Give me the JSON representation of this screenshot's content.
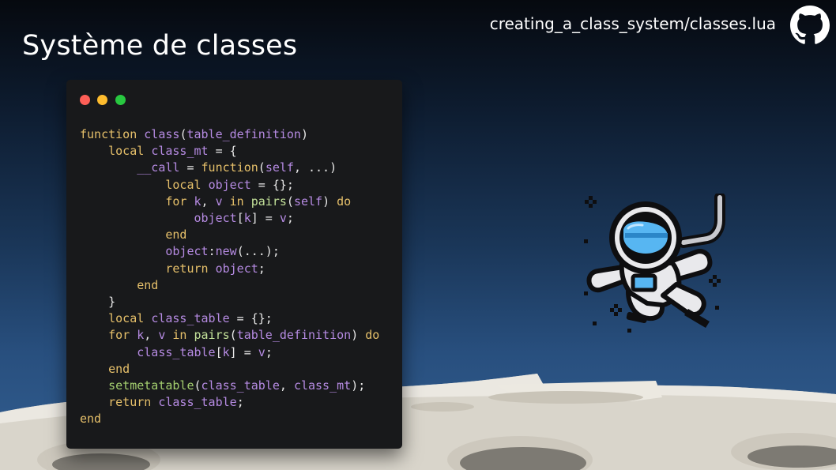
{
  "slide": {
    "title": "Système de classes",
    "file_path": "creating_a_class_system/classes.lua"
  },
  "icons": {
    "github": "github-icon",
    "astronaut": "astronaut-illustration"
  },
  "colors": {
    "background_top": "#06090f",
    "background_bottom": "#335f92",
    "code_background": "#18191b",
    "keyword": "#e6c06a",
    "identifier": "#b68be3",
    "function_call": "#a4cf6f",
    "dot_red": "#fe5f57",
    "dot_yellow": "#febc2e",
    "dot_green": "#28c840"
  },
  "code": {
    "lines": [
      [
        [
          "kw",
          "function "
        ],
        [
          "id",
          "class"
        ],
        [
          "pl",
          "("
        ],
        [
          "id",
          "table_definition"
        ],
        [
          "pl",
          ")"
        ]
      ],
      [
        [
          "pl",
          "    "
        ],
        [
          "kw",
          "local "
        ],
        [
          "id",
          "class_mt"
        ],
        [
          "pl",
          " = {"
        ]
      ],
      [
        [
          "pl",
          "        "
        ],
        [
          "id",
          "__call"
        ],
        [
          "pl",
          " = "
        ],
        [
          "kw",
          "function"
        ],
        [
          "pl",
          "("
        ],
        [
          "id",
          "self"
        ],
        [
          "pl",
          ", ...)"
        ]
      ],
      [
        [
          "pl",
          "            "
        ],
        [
          "kw",
          "local "
        ],
        [
          "id",
          "object"
        ],
        [
          "pl",
          " = {};"
        ]
      ],
      [
        [
          "pl",
          "            "
        ],
        [
          "kw",
          "for "
        ],
        [
          "id",
          "k"
        ],
        [
          "pl",
          ", "
        ],
        [
          "id",
          "v"
        ],
        [
          "kw",
          " in "
        ],
        [
          "nl",
          "pairs"
        ],
        [
          "pl",
          "("
        ],
        [
          "id",
          "self"
        ],
        [
          "pl",
          ") "
        ],
        [
          "kw",
          "do"
        ]
      ],
      [
        [
          "pl",
          "                "
        ],
        [
          "id",
          "object"
        ],
        [
          "pl",
          "["
        ],
        [
          "id",
          "k"
        ],
        [
          "pl",
          "] = "
        ],
        [
          "id",
          "v"
        ],
        [
          "pl",
          ";"
        ]
      ],
      [
        [
          "pl",
          "            "
        ],
        [
          "kw",
          "end"
        ]
      ],
      [
        [
          "pl",
          "            "
        ],
        [
          "id",
          "object"
        ],
        [
          "pl",
          ":"
        ],
        [
          "id",
          "new"
        ],
        [
          "pl",
          "(...);"
        ]
      ],
      [
        [
          "pl",
          "            "
        ],
        [
          "kw",
          "return "
        ],
        [
          "id",
          "object"
        ],
        [
          "pl",
          ";"
        ]
      ],
      [
        [
          "pl",
          "        "
        ],
        [
          "kw",
          "end"
        ]
      ],
      [
        [
          "pl",
          "    }"
        ]
      ],
      [
        [
          "pl",
          "    "
        ],
        [
          "kw",
          "local "
        ],
        [
          "id",
          "class_table"
        ],
        [
          "pl",
          " = {};"
        ]
      ],
      [
        [
          "pl",
          "    "
        ],
        [
          "kw",
          "for "
        ],
        [
          "id",
          "k"
        ],
        [
          "pl",
          ", "
        ],
        [
          "id",
          "v"
        ],
        [
          "kw",
          " in "
        ],
        [
          "nl",
          "pairs"
        ],
        [
          "pl",
          "("
        ],
        [
          "id",
          "table_definition"
        ],
        [
          "pl",
          ") "
        ],
        [
          "kw",
          "do"
        ]
      ],
      [
        [
          "pl",
          "        "
        ],
        [
          "id",
          "class_table"
        ],
        [
          "pl",
          "["
        ],
        [
          "id",
          "k"
        ],
        [
          "pl",
          "] = "
        ],
        [
          "id",
          "v"
        ],
        [
          "pl",
          ";"
        ]
      ],
      [
        [
          "pl",
          "    "
        ],
        [
          "kw",
          "end"
        ]
      ],
      [
        [
          "pl",
          "    "
        ],
        [
          "fn",
          "setmetatable"
        ],
        [
          "pl",
          "("
        ],
        [
          "id",
          "class_table"
        ],
        [
          "pl",
          ", "
        ],
        [
          "id",
          "class_mt"
        ],
        [
          "pl",
          ");"
        ]
      ],
      [
        [
          "pl",
          "    "
        ],
        [
          "kw",
          "return "
        ],
        [
          "id",
          "class_table"
        ],
        [
          "pl",
          ";"
        ]
      ],
      [
        [
          "kw",
          "end"
        ]
      ]
    ]
  }
}
